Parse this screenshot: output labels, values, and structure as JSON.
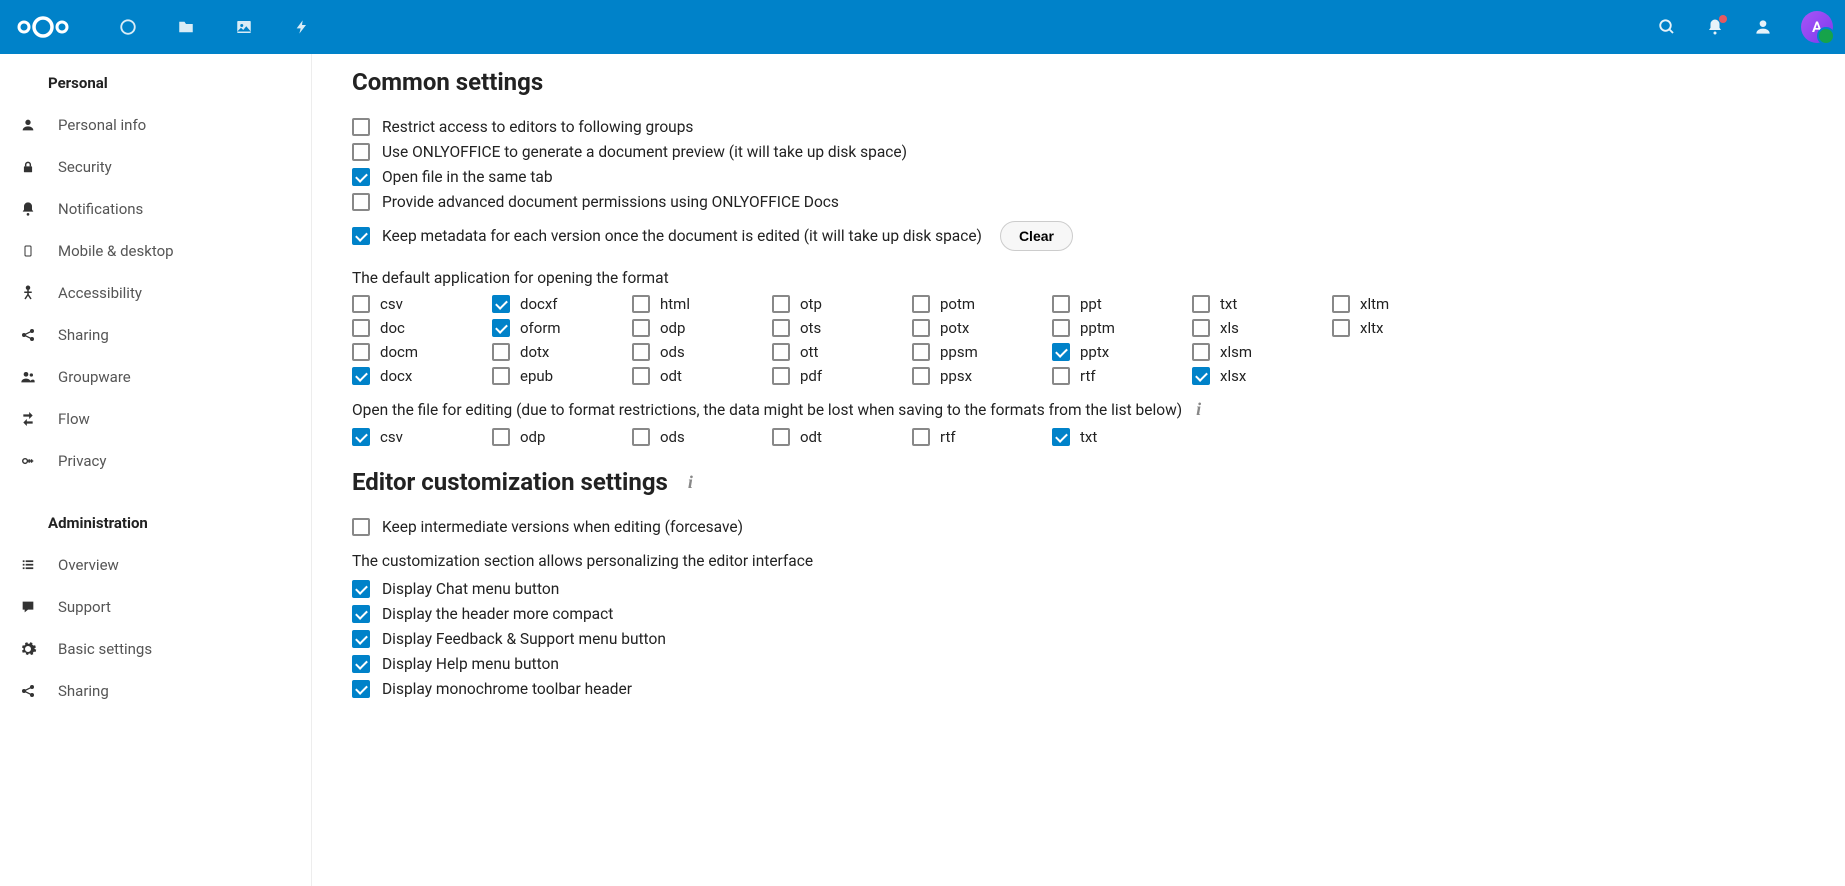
{
  "header": {
    "avatar_initial": "A"
  },
  "sidebar": {
    "personal_header": "Personal",
    "admin_header": "Administration",
    "personal_items": [
      {
        "label": "Personal info",
        "icon": "user"
      },
      {
        "label": "Security",
        "icon": "lock"
      },
      {
        "label": "Notifications",
        "icon": "bell"
      },
      {
        "label": "Mobile & desktop",
        "icon": "phone"
      },
      {
        "label": "Accessibility",
        "icon": "person"
      },
      {
        "label": "Sharing",
        "icon": "share"
      },
      {
        "label": "Groupware",
        "icon": "users"
      },
      {
        "label": "Flow",
        "icon": "arrow"
      },
      {
        "label": "Privacy",
        "icon": "key"
      }
    ],
    "admin_items": [
      {
        "label": "Overview",
        "icon": "list"
      },
      {
        "label": "Support",
        "icon": "chat"
      },
      {
        "label": "Basic settings",
        "icon": "gear"
      },
      {
        "label": "Sharing",
        "icon": "share"
      }
    ]
  },
  "common": {
    "title": "Common settings",
    "options": [
      {
        "label": "Restrict access to editors to following groups",
        "checked": false
      },
      {
        "label": "Use ONLYOFFICE to generate a document preview (it will take up disk space)",
        "checked": false
      },
      {
        "label": "Open file in the same tab",
        "checked": true
      },
      {
        "label": "Provide advanced document permissions using ONLYOFFICE Docs",
        "checked": false
      }
    ],
    "metadata": {
      "label": "Keep metadata for each version once the document is edited (it will take up disk space)",
      "checked": true
    },
    "clear_btn": "Clear",
    "default_app_label": "The default application for opening the format",
    "formats": [
      {
        "label": "csv",
        "checked": false
      },
      {
        "label": "docxf",
        "checked": true
      },
      {
        "label": "html",
        "checked": false
      },
      {
        "label": "otp",
        "checked": false
      },
      {
        "label": "potm",
        "checked": false
      },
      {
        "label": "ppt",
        "checked": false
      },
      {
        "label": "txt",
        "checked": false
      },
      {
        "label": "xltm",
        "checked": false
      },
      null,
      {
        "label": "doc",
        "checked": false
      },
      {
        "label": "oform",
        "checked": true
      },
      {
        "label": "odp",
        "checked": false
      },
      {
        "label": "ots",
        "checked": false
      },
      {
        "label": "potx",
        "checked": false
      },
      {
        "label": "pptm",
        "checked": false
      },
      {
        "label": "xls",
        "checked": false
      },
      {
        "label": "xltx",
        "checked": false
      },
      null,
      {
        "label": "docm",
        "checked": false
      },
      {
        "label": "dotx",
        "checked": false
      },
      {
        "label": "ods",
        "checked": false
      },
      {
        "label": "ott",
        "checked": false
      },
      {
        "label": "ppsm",
        "checked": false
      },
      {
        "label": "pptx",
        "checked": true
      },
      {
        "label": "xlsm",
        "checked": false
      },
      null,
      null,
      {
        "label": "docx",
        "checked": true
      },
      {
        "label": "epub",
        "checked": false
      },
      {
        "label": "odt",
        "checked": false
      },
      {
        "label": "pdf",
        "checked": false
      },
      {
        "label": "ppsx",
        "checked": false
      },
      {
        "label": "rtf",
        "checked": false
      },
      {
        "label": "xlsx",
        "checked": true
      },
      null,
      null
    ],
    "edit_label": "Open the file for editing (due to format restrictions, the data might be lost when saving to the formats from the list below)",
    "edit_formats": [
      {
        "label": "csv",
        "checked": true
      },
      {
        "label": "odp",
        "checked": false
      },
      {
        "label": "ods",
        "checked": false
      },
      {
        "label": "odt",
        "checked": false
      },
      {
        "label": "rtf",
        "checked": false
      },
      {
        "label": "txt",
        "checked": true
      }
    ]
  },
  "editor": {
    "title": "Editor customization settings",
    "forcesave": {
      "label": "Keep intermediate versions when editing (forcesave)",
      "checked": false
    },
    "desc": "The customization section allows personalizing the editor interface",
    "options": [
      {
        "label": "Display Chat menu button",
        "checked": true
      },
      {
        "label": "Display the header more compact",
        "checked": true
      },
      {
        "label": "Display Feedback & Support menu button",
        "checked": true
      },
      {
        "label": "Display Help menu button",
        "checked": true
      },
      {
        "label": "Display monochrome toolbar header",
        "checked": true
      }
    ]
  }
}
